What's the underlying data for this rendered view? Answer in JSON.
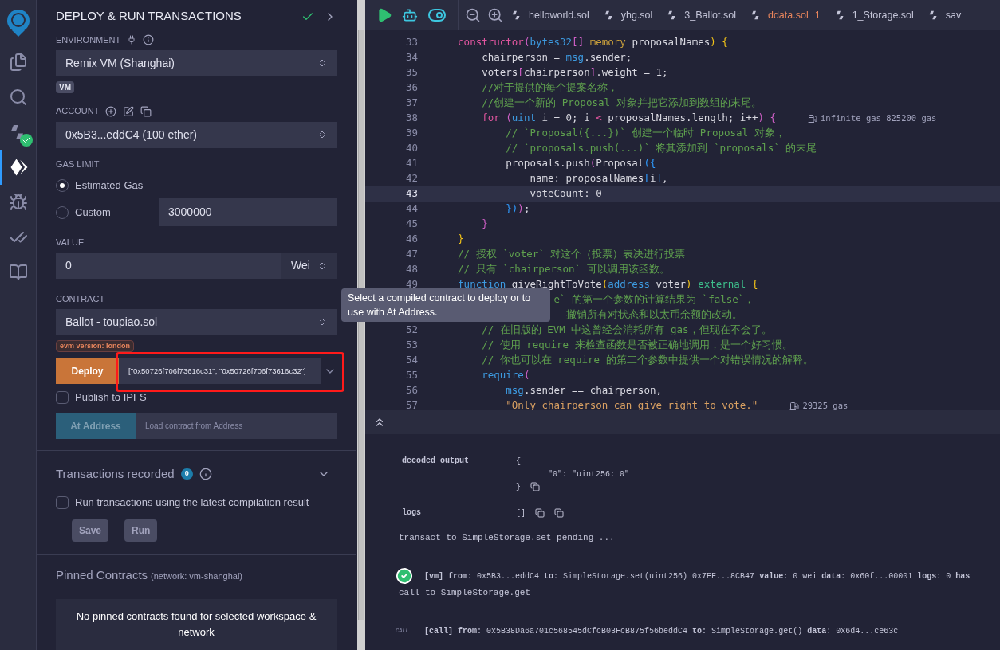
{
  "activity_bar": {
    "items": [
      {
        "kind": "files",
        "selected": false
      },
      {
        "kind": "search",
        "selected": false
      },
      {
        "kind": "compiler",
        "selected": false
      },
      {
        "kind": "deploy",
        "selected": true
      },
      {
        "kind": "debugger",
        "selected": false
      },
      {
        "kind": "tests",
        "selected": false
      },
      {
        "kind": "learn",
        "selected": false
      }
    ]
  },
  "panel": {
    "title": "DEPLOY & RUN TRANSACTIONS",
    "environment": {
      "label": "ENVIRONMENT",
      "value": "Remix VM (Shanghai)",
      "badge": "VM"
    },
    "account": {
      "label": "ACCOUNT",
      "value": "0x5B3...eddC4 (100 ether)"
    },
    "gas_limit": {
      "label": "GAS LIMIT",
      "options": [
        {
          "label": "Estimated Gas",
          "selected": true
        },
        {
          "label": "Custom",
          "selected": false
        }
      ],
      "value": "3000000"
    },
    "value": {
      "label": "VALUE",
      "amount": "0",
      "unit": "Wei"
    },
    "contract": {
      "label": "CONTRACT",
      "value": "Ballot - toupiao.sol",
      "evm_badge": "evm version: london"
    },
    "deploy": {
      "button": "Deploy",
      "args": "[\"0x50726f706f73616c31\", \"0x50726f706f73616c32\"]",
      "highlight": true
    },
    "publish": {
      "label": "Publish to IPFS",
      "checked": false
    },
    "at_address": {
      "button": "At Address",
      "placeholder": "Load contract from Address"
    },
    "transactions": {
      "title": "Transactions recorded",
      "count": "0",
      "checkbox_label": "Run transactions using the latest compilation result",
      "checked": false,
      "buttons": [
        "Save",
        "Run"
      ]
    },
    "pinned": {
      "title": "Pinned Contracts",
      "network": "(network: vm-shanghai)",
      "empty_text": "No pinned contracts found for selected workspace & network"
    }
  },
  "tooltip": {
    "text": "Select a compiled contract to deploy or to use with At Address."
  },
  "tabs": [
    {
      "label": "helloworld.sol",
      "warning": false
    },
    {
      "label": "yhg.sol",
      "warning": false
    },
    {
      "label": "3_Ballot.sol",
      "warning": false
    },
    {
      "label": "ddata.sol",
      "warning": true,
      "count": "1"
    },
    {
      "label": "1_Storage.sol",
      "warning": false
    },
    {
      "label": "sav",
      "warning": false
    }
  ],
  "editor": {
    "lines": [
      {
        "number": "33",
        "current": false,
        "tokens": [
          {
            "kind": "kw",
            "t": "    constructor"
          },
          {
            "kind": "b2",
            "t": "("
          },
          {
            "kind": "ty",
            "t": "bytes32"
          },
          {
            "kind": "b2",
            "t": "[]"
          },
          {
            "kind": "mem",
            "t": " memory"
          },
          {
            "kind": "p",
            "t": " proposalNames"
          },
          {
            "kind": "b1",
            "t": ")"
          },
          {
            "kind": "b1",
            "t": " {"
          }
        ]
      },
      {
        "number": "34",
        "current": false,
        "tokens": [
          {
            "kind": "p",
            "t": "        chairperson = "
          },
          {
            "kind": "ty",
            "t": "msg"
          },
          {
            "kind": "p",
            "t": ".sender;"
          }
        ]
      },
      {
        "number": "35",
        "current": false,
        "tokens": [
          {
            "kind": "p",
            "t": "        voters"
          },
          {
            "kind": "b2",
            "t": "["
          },
          {
            "kind": "p",
            "t": "chairperson"
          },
          {
            "kind": "b2",
            "t": "]"
          },
          {
            "kind": "p",
            "t": ".weight = 1;"
          }
        ]
      },
      {
        "number": "36",
        "current": false,
        "tokens": [
          {
            "kind": "cm",
            "t": "        //对于提供的每个提案名称，"
          }
        ]
      },
      {
        "number": "37",
        "current": false,
        "tokens": [
          {
            "kind": "cm",
            "t": "        //创建一个新的 Proposal 对象并把它添加到数组的末尾。"
          }
        ]
      },
      {
        "number": "38",
        "current": false,
        "gas": "infinite gas 825200 gas",
        "tokens": [
          {
            "kind": "kw",
            "t": "        for"
          },
          {
            "kind": "b2",
            "t": " ("
          },
          {
            "kind": "ty",
            "t": "uint"
          },
          {
            "kind": "p",
            "t": " i = 0; i "
          },
          {
            "kind": "kw",
            "t": "<"
          },
          {
            "kind": "p",
            "t": " proposalNames.length; i++"
          },
          {
            "kind": "b2",
            "t": ")"
          },
          {
            "kind": "b2",
            "t": " {"
          }
        ]
      },
      {
        "number": "39",
        "current": false,
        "tokens": [
          {
            "kind": "cm",
            "t": "            // `Proposal({...})` 创建一个临时 Proposal 对象，"
          }
        ]
      },
      {
        "number": "40",
        "current": false,
        "tokens": [
          {
            "kind": "cm",
            "t": "            // `proposals.push(...)` 将其添加到 `proposals` 的末尾"
          }
        ]
      },
      {
        "number": "41",
        "current": false,
        "tokens": [
          {
            "kind": "p",
            "t": "            proposals.push"
          },
          {
            "kind": "b2",
            "t": "("
          },
          {
            "kind": "p",
            "t": "Proposal"
          },
          {
            "kind": "b3",
            "t": "({"
          }
        ]
      },
      {
        "number": "42",
        "current": false,
        "tokens": [
          {
            "kind": "p",
            "t": "                name: proposalNames"
          },
          {
            "kind": "b3",
            "t": "["
          },
          {
            "kind": "p",
            "t": "i"
          },
          {
            "kind": "b3",
            "t": "]"
          },
          {
            "kind": "p",
            "t": ","
          }
        ]
      },
      {
        "number": "43",
        "current": true,
        "tokens": [
          {
            "kind": "p",
            "t": "                voteCount: 0"
          }
        ]
      },
      {
        "number": "44",
        "current": false,
        "tokens": [
          {
            "kind": "b3",
            "t": "            })"
          },
          {
            "kind": "b2",
            "t": ")"
          },
          {
            "kind": "p",
            "t": ";"
          }
        ]
      },
      {
        "number": "45",
        "current": false,
        "tokens": [
          {
            "kind": "b2",
            "t": "        }"
          }
        ]
      },
      {
        "number": "46",
        "current": false,
        "tokens": [
          {
            "kind": "b1",
            "t": "    }"
          }
        ]
      },
      {
        "number": "47",
        "current": false,
        "tokens": [
          {
            "kind": "cm",
            "t": "    // 授权 `voter` 对这个（投票）表决进行投票"
          }
        ]
      },
      {
        "number": "48",
        "current": false,
        "tokens": [
          {
            "kind": "cm",
            "t": "    // 只有 `chairperson` 可以调用该函数。"
          }
        ]
      },
      {
        "number": "49",
        "current": false,
        "tokens": [
          {
            "kind": "ty",
            "t": "    function"
          },
          {
            "kind": "p",
            "t": " giveRightToVote"
          },
          {
            "kind": "b1",
            "t": "("
          },
          {
            "kind": "ty",
            "t": "address"
          },
          {
            "kind": "p",
            "t": " voter"
          },
          {
            "kind": "b1",
            "t": ")"
          },
          {
            "kind": "ext",
            "t": " external"
          },
          {
            "kind": "b1",
            "t": " {"
          }
        ]
      },
      {
        "tokens": [
          {
            "kind": "cm",
            "t": "                    e` 的第一个参数的计算结果为 `false`，"
          }
        ]
      },
      {
        "tokens": [
          {
            "kind": "cm",
            "t": "                      撤销所有对状态和以太币余额的改动。"
          }
        ]
      },
      {
        "number": "52",
        "current": false,
        "tokens": [
          {
            "kind": "cm",
            "t": "        // 在旧版的 EVM 中这曾经会消耗所有 gas，但现在不会了。"
          }
        ]
      },
      {
        "number": "53",
        "current": false,
        "tokens": [
          {
            "kind": "cm",
            "t": "        // 使用 require 来检查函数是否被正确地调用，是一个好习惯。"
          }
        ]
      },
      {
        "number": "54",
        "current": false,
        "tokens": [
          {
            "kind": "cm",
            "t": "        // 你也可以在 require 的第二个参数中提供一个对错误情况的解释。"
          }
        ]
      },
      {
        "number": "55",
        "current": false,
        "tokens": [
          {
            "kind": "ty",
            "t": "        require"
          },
          {
            "kind": "b2",
            "t": "("
          }
        ]
      },
      {
        "number": "56",
        "current": false,
        "tokens": [
          {
            "kind": "ty",
            "t": "            msg"
          },
          {
            "kind": "p",
            "t": ".sender == chairperson,"
          }
        ]
      },
      {
        "number": "57",
        "current": false,
        "gas": "29325 gas",
        "tokens": [
          {
            "kind": "str",
            "t": "            \"Only chairperson can give right to vote.\""
          }
        ]
      }
    ]
  },
  "terminal": {
    "rows": [
      {
        "kind": "field",
        "label": "decoded output",
        "values": [
          "{",
          "\"0\": \"uint256: 0\"",
          "}"
        ]
      },
      {
        "kind": "field",
        "label": "logs",
        "values": [
          "[]"
        ]
      },
      {
        "kind": "text",
        "text": "transact to SimpleStorage.set pending ..."
      },
      {
        "kind": "vm_tx",
        "text": "**[vm]**  **from**: 0x5B3...eddC4 **to**: SimpleStorage.set(uint256) 0x7EF...8CB47 **value**: 0 wei **data**: 0x60f...00001 **logs**: 0 **has**"
      },
      {
        "kind": "text",
        "text": "call to SimpleStorage.get"
      },
      {
        "kind": "call_tx",
        "label": "CALL",
        "text": "**[call]**  **from**: 0x5B38Da6a701c568545dCfcB03FcB875f56beddC4 **to**: SimpleStorage.get() **data**: 0x6d4...ce63c"
      }
    ]
  }
}
